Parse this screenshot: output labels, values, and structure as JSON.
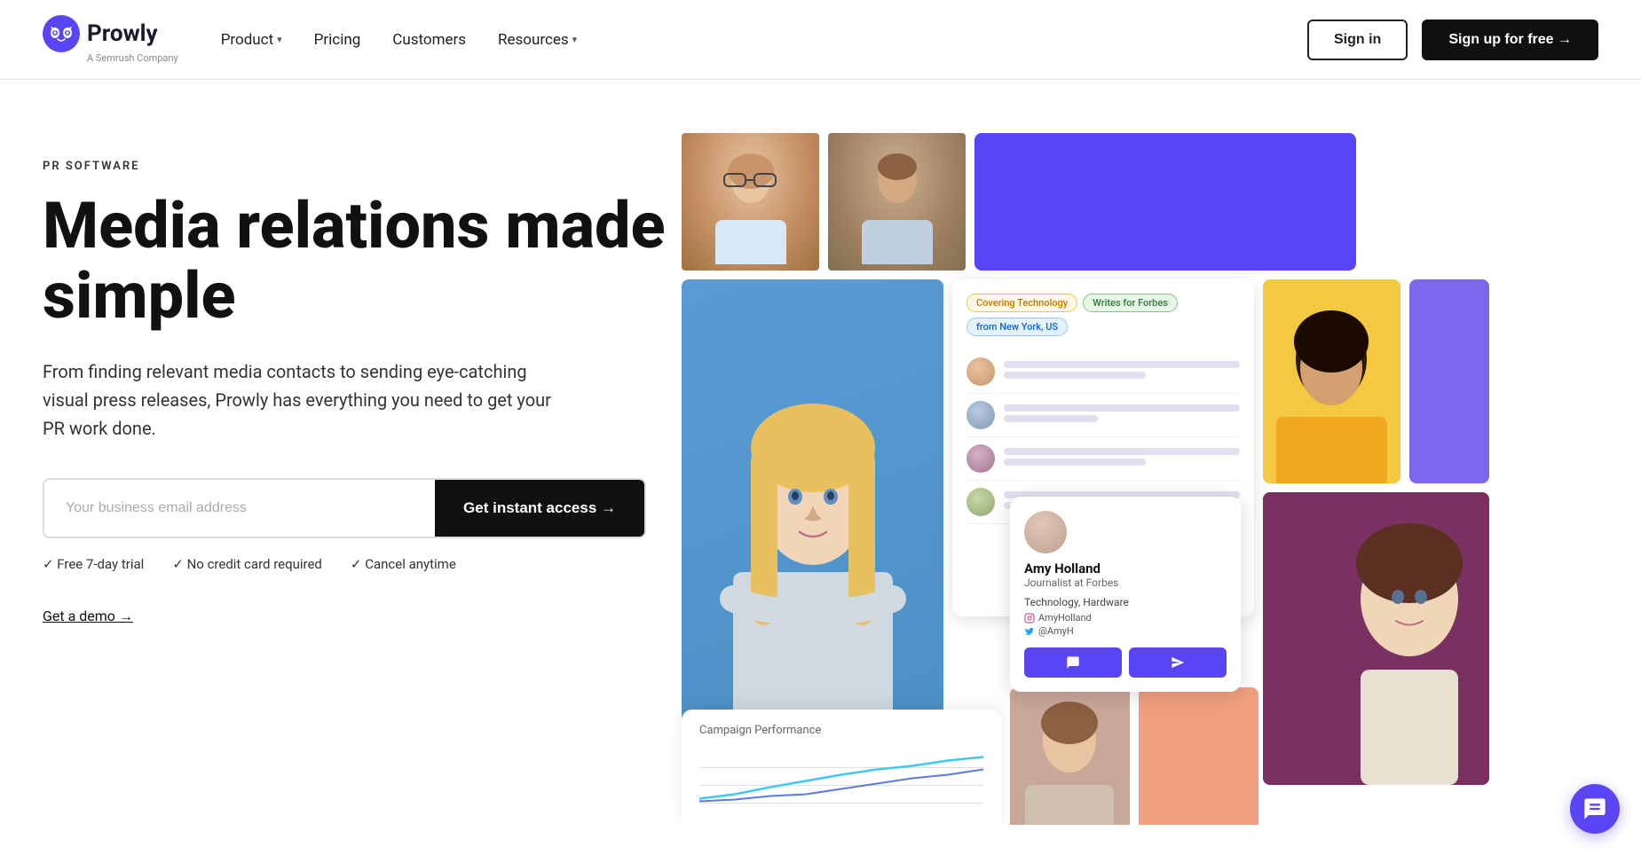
{
  "brand": {
    "name": "Prowly",
    "tagline": "A Semrush Company",
    "icon_color": "#5a45f5"
  },
  "nav": {
    "links": [
      {
        "label": "Product",
        "has_dropdown": true
      },
      {
        "label": "Pricing",
        "has_dropdown": false
      },
      {
        "label": "Customers",
        "has_dropdown": false
      },
      {
        "label": "Resources",
        "has_dropdown": true
      }
    ],
    "signin_label": "Sign in",
    "signup_label": "Sign up for free →"
  },
  "hero": {
    "eyebrow": "PR SOFTWARE",
    "title": "Media relations made simple",
    "description": "From finding relevant media contacts to sending eye-catching visual press releases, Prowly has everything you need to get your PR work done.",
    "email_placeholder": "Your business email address",
    "cta_label": "Get instant access →",
    "perks": [
      "✓  Free 7-day trial",
      "✓  No credit card required",
      "✓  Cancel anytime"
    ],
    "demo_label": "Get a demo →"
  },
  "contact_card": {
    "tags": [
      "Covering Technology",
      "Writes for Forbes",
      "from New York, US"
    ],
    "amy": {
      "name": "Amy Holland",
      "title": "Journalist at Forbes",
      "field": "Technology, Hardware",
      "social": [
        "AmyHolland",
        "@AmyH"
      ]
    }
  },
  "campaign": {
    "title": "Campaign Performance"
  },
  "chat": {
    "icon": "💬"
  }
}
